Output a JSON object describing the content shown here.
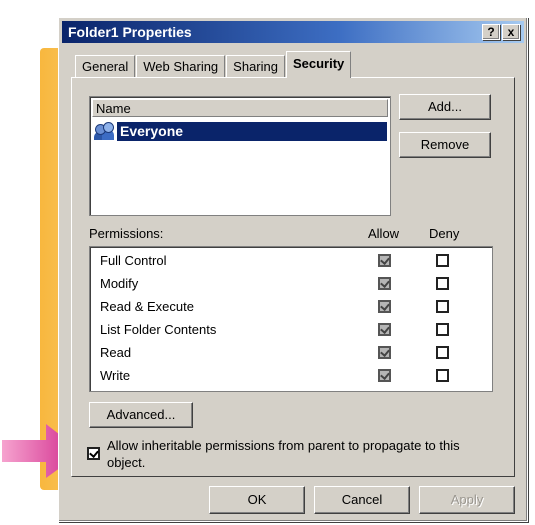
{
  "window": {
    "title": "Folder1 Properties",
    "help_label": "?",
    "close_label": "x"
  },
  "tabs": [
    {
      "label": "General"
    },
    {
      "label": "Web Sharing"
    },
    {
      "label": "Sharing"
    },
    {
      "label": "Security",
      "active": true
    }
  ],
  "names_list": {
    "header": "Name",
    "items": [
      {
        "label": "Everyone",
        "icon": "users-group-icon",
        "selected": true
      }
    ]
  },
  "buttons": {
    "add": "Add...",
    "remove": "Remove",
    "advanced": "Advanced...",
    "ok": "OK",
    "cancel": "Cancel",
    "apply": "Apply"
  },
  "permissions": {
    "label": "Permissions:",
    "allow_header": "Allow",
    "deny_header": "Deny",
    "rows": [
      {
        "name": "Full Control",
        "allow": true,
        "deny": false
      },
      {
        "name": "Modify",
        "allow": true,
        "deny": false
      },
      {
        "name": "Read & Execute",
        "allow": true,
        "deny": false
      },
      {
        "name": "List Folder Contents",
        "allow": true,
        "deny": false
      },
      {
        "name": "Read",
        "allow": true,
        "deny": false
      },
      {
        "name": "Write",
        "allow": true,
        "deny": false
      }
    ]
  },
  "inherit": {
    "text": "Allow inheritable permissions from parent to propagate to this object.",
    "checked": true
  },
  "colors": {
    "titlebar": "#0a246a",
    "dialog_face": "#d4d0c8",
    "highlight_arrow": "#e6489b"
  }
}
